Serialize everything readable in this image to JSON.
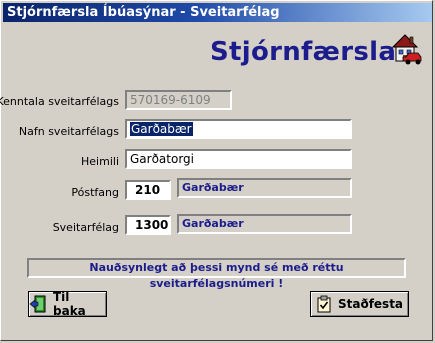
{
  "window": {
    "title": "Stjórnfærsla Íbúasýnar - Sveitarfélag"
  },
  "header": {
    "title": "Stjórnfærsla",
    "logo_icon": "house-car-icon"
  },
  "form": {
    "kennitala": {
      "label": "Kenntala sveitarfélags",
      "value": "570169-6109"
    },
    "nafn": {
      "label": "Nafn sveitarfélags",
      "value": "Garðabær"
    },
    "heimili": {
      "label": "Heimili",
      "value": "Garðatorgi"
    },
    "postfang": {
      "label": "Póstfang",
      "number": "210",
      "name": "Garðabær"
    },
    "sveitarfelag": {
      "label": "Sveitarfélag",
      "number": "1300",
      "name": "Garðabær"
    }
  },
  "notice": "Nauðsynlegt að þessi mynd sé með réttu sveitarfélagsnúmeri !",
  "buttons": {
    "back": {
      "label": "Til baka",
      "icon": "door-exit-icon"
    },
    "confirm": {
      "label": "Staðfesta",
      "icon": "clipboard-check-icon"
    }
  },
  "colors": {
    "title_gradient_start": "#0a246a",
    "title_gradient_end": "#a6caf0",
    "accent_text": "#1c1c8c"
  }
}
